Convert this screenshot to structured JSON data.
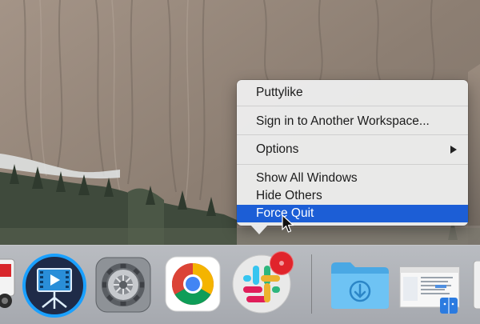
{
  "context_menu": {
    "items": [
      {
        "label": "Puttylike"
      },
      {
        "label": "Sign in to Another Workspace..."
      },
      {
        "label": "Options"
      },
      {
        "label": "Show All Windows"
      },
      {
        "label": "Hide Others"
      },
      {
        "label": "Force Quit"
      }
    ],
    "highlighted_item": "Force Quit",
    "highlight_color": "#1c5ed6"
  },
  "dock": {
    "apps": [
      {
        "icon": "red-app-icon"
      },
      {
        "icon": "video-screen-recorder-icon"
      },
      {
        "icon": "system-preferences-gear-icon"
      },
      {
        "icon": "chrome-icon"
      },
      {
        "icon": "slack-icon",
        "badge_color": "#e0242b"
      },
      {
        "icon": "downloads-folder-icon"
      },
      {
        "icon": "finder-window-thumbnail"
      }
    ]
  }
}
